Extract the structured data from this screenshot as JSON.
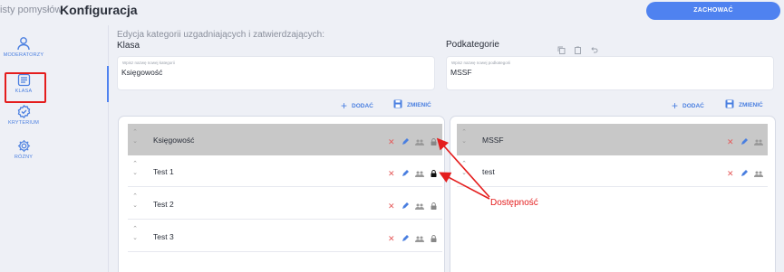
{
  "header": {
    "breadcrumb": "isty pomysłów",
    "title": "Konfiguracja",
    "save_label": "ZACHOWAĆ"
  },
  "sidebar": {
    "items": [
      {
        "label": "MODERATORZY",
        "icon": "user-icon"
      },
      {
        "label": "KLASA",
        "icon": "list-icon"
      },
      {
        "label": "KRYTERIUM",
        "icon": "check-badge-icon"
      },
      {
        "label": "RÓŻNY",
        "icon": "gear-icon"
      }
    ]
  },
  "main": {
    "section_title": "Edycja kategorii uzgadniających i zatwierdzających:",
    "left": {
      "title": "Klasa",
      "input_placeholder": "Wpisz nazwę nowej kategorii",
      "input_value": "Księgowość",
      "add_label": "DODAĆ",
      "change_label": "ZMIENIĆ",
      "rows": [
        {
          "label": "Księgowość",
          "selected": true
        },
        {
          "label": "Test 1",
          "selected": false
        },
        {
          "label": "Test 2",
          "selected": false
        },
        {
          "label": "Test 3",
          "selected": false
        }
      ]
    },
    "right": {
      "title": "Podkategorie",
      "input_placeholder": "Wpisz nazwę nowej podkategorii",
      "input_value": "MSSF",
      "add_label": "DODAĆ",
      "change_label": "ZMIENIĆ",
      "rows": [
        {
          "label": "MSSF",
          "selected": true
        },
        {
          "label": "test",
          "selected": false
        }
      ]
    }
  },
  "annotation": {
    "text": "Dostępność",
    "color": "#e41d1d"
  },
  "colors": {
    "accent": "#4f82f0",
    "delete": "#e55a5a",
    "selected_row": "#c8c8c8"
  }
}
